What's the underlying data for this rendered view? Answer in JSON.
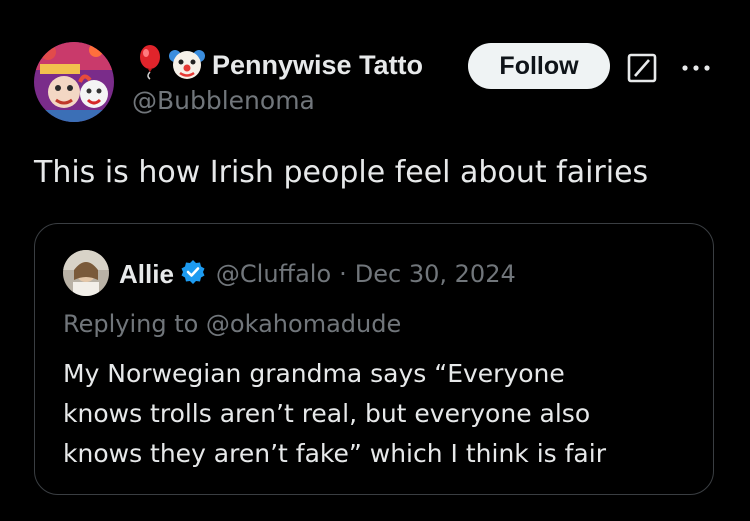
{
  "author": {
    "display_name": "Pennywise Tatto",
    "handle": "@Bubblenoma",
    "name_emojis": [
      "balloon-icon",
      "clown-face-icon"
    ],
    "avatar": "pennywise-avatar"
  },
  "actions": {
    "follow_label": "Follow",
    "grok_icon": "grok-icon",
    "more_icon": "more-options-icon"
  },
  "tweet": {
    "text": "This is how Irish people feel about fairies"
  },
  "quoted": {
    "name": "Allie",
    "verified": true,
    "handle": "@Cluffalo",
    "separator": "·",
    "date": "Dec 30, 2024",
    "replying_to": "Replying to @okahomadude",
    "body_lines": [
      "My Norwegian grandma says “Everyone",
      "knows trolls aren’t real, but everyone also",
      "knows they aren’t fake” which I think is fair"
    ]
  },
  "colors": {
    "background": "#000000",
    "text_primary": "#e7e9ea",
    "text_secondary": "#71767b",
    "follow_bg": "#eff3f4",
    "verified_blue": "#1d9bf0",
    "card_border": "#3a3e42"
  }
}
